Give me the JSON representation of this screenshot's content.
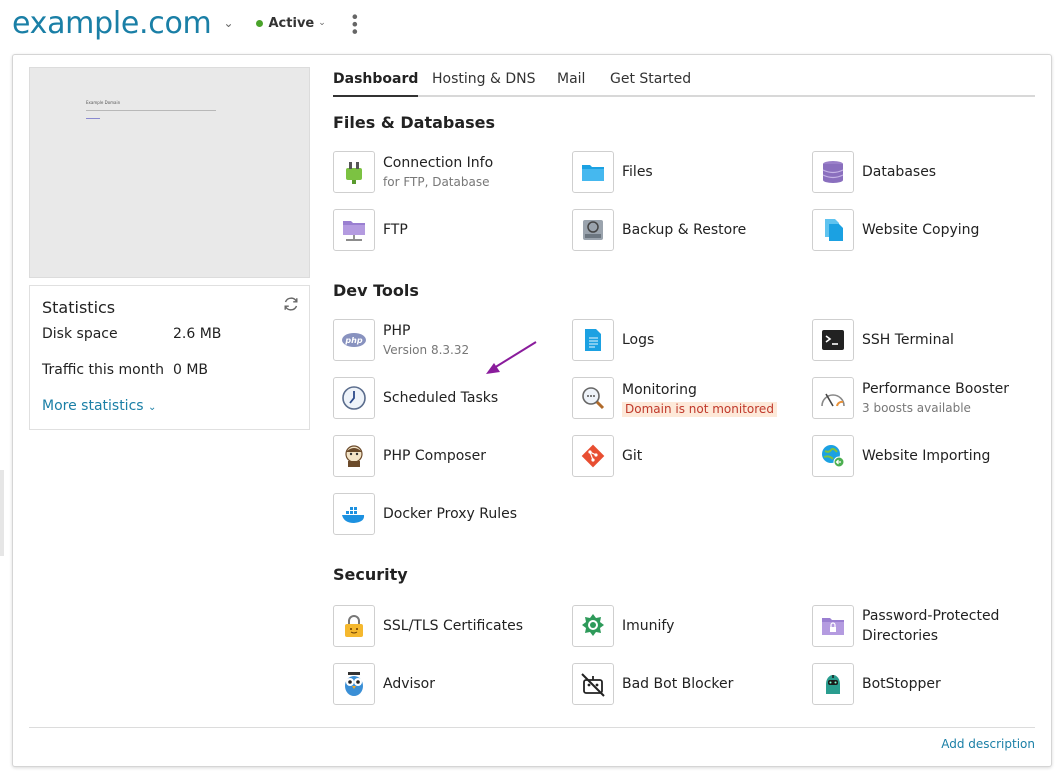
{
  "header": {
    "domain": "example.com",
    "status": "Active",
    "colors": {
      "brand": "#1a7fa6",
      "status_dot": "#4aa32a"
    }
  },
  "preview": {
    "title": "Example Domain"
  },
  "statistics": {
    "title": "Statistics",
    "rows": [
      {
        "label": "Disk space",
        "value": "2.6 MB"
      },
      {
        "label": "Traffic this month",
        "value": "0 MB"
      }
    ],
    "more_link": "More statistics"
  },
  "tabs": [
    {
      "label": "Dashboard",
      "active": true
    },
    {
      "label": "Hosting & DNS",
      "active": false
    },
    {
      "label": "Mail",
      "active": false
    },
    {
      "label": "Get Started",
      "active": false
    }
  ],
  "sections": {
    "files": {
      "title": "Files & Databases",
      "tools": [
        {
          "name": "Connection Info",
          "sub": "for FTP, Database",
          "icon": "plug-icon"
        },
        {
          "name": "Files",
          "icon": "folder-icon"
        },
        {
          "name": "Databases",
          "icon": "database-icon"
        },
        {
          "name": "FTP",
          "icon": "ftp-folder-icon"
        },
        {
          "name": "Backup & Restore",
          "icon": "backup-icon"
        },
        {
          "name": "Website Copying",
          "icon": "copy-docs-icon"
        }
      ]
    },
    "dev": {
      "title": "Dev Tools",
      "tools": [
        {
          "name": "PHP",
          "sub": "Version 8.3.32",
          "icon": "php-icon"
        },
        {
          "name": "Logs",
          "icon": "log-doc-icon"
        },
        {
          "name": "SSH Terminal",
          "icon": "terminal-icon"
        },
        {
          "name": "Scheduled Tasks",
          "icon": "clock-icon"
        },
        {
          "name": "Monitoring",
          "badge": "Domain is not monitored",
          "icon": "magnifier-icon"
        },
        {
          "name": "Performance Booster",
          "sub": "3 boosts available",
          "icon": "gauge-icon"
        },
        {
          "name": "PHP Composer",
          "icon": "composer-icon"
        },
        {
          "name": "Git",
          "icon": "git-icon"
        },
        {
          "name": "Website Importing",
          "icon": "globe-import-icon"
        },
        {
          "name": "Docker Proxy Rules",
          "icon": "docker-icon"
        }
      ]
    },
    "security": {
      "title": "Security",
      "tools": [
        {
          "name": "SSL/TLS Certificates",
          "icon": "lock-icon"
        },
        {
          "name": "Imunify",
          "icon": "imunify-icon"
        },
        {
          "name": "Password-Protected Directories",
          "icon": "locked-folder-icon"
        },
        {
          "name": "Advisor",
          "icon": "owl-icon"
        },
        {
          "name": "Bad Bot Blocker",
          "icon": "bot-blocked-icon"
        },
        {
          "name": "BotStopper",
          "icon": "bot-icon"
        }
      ]
    }
  },
  "footer": {
    "add_description": "Add description"
  }
}
